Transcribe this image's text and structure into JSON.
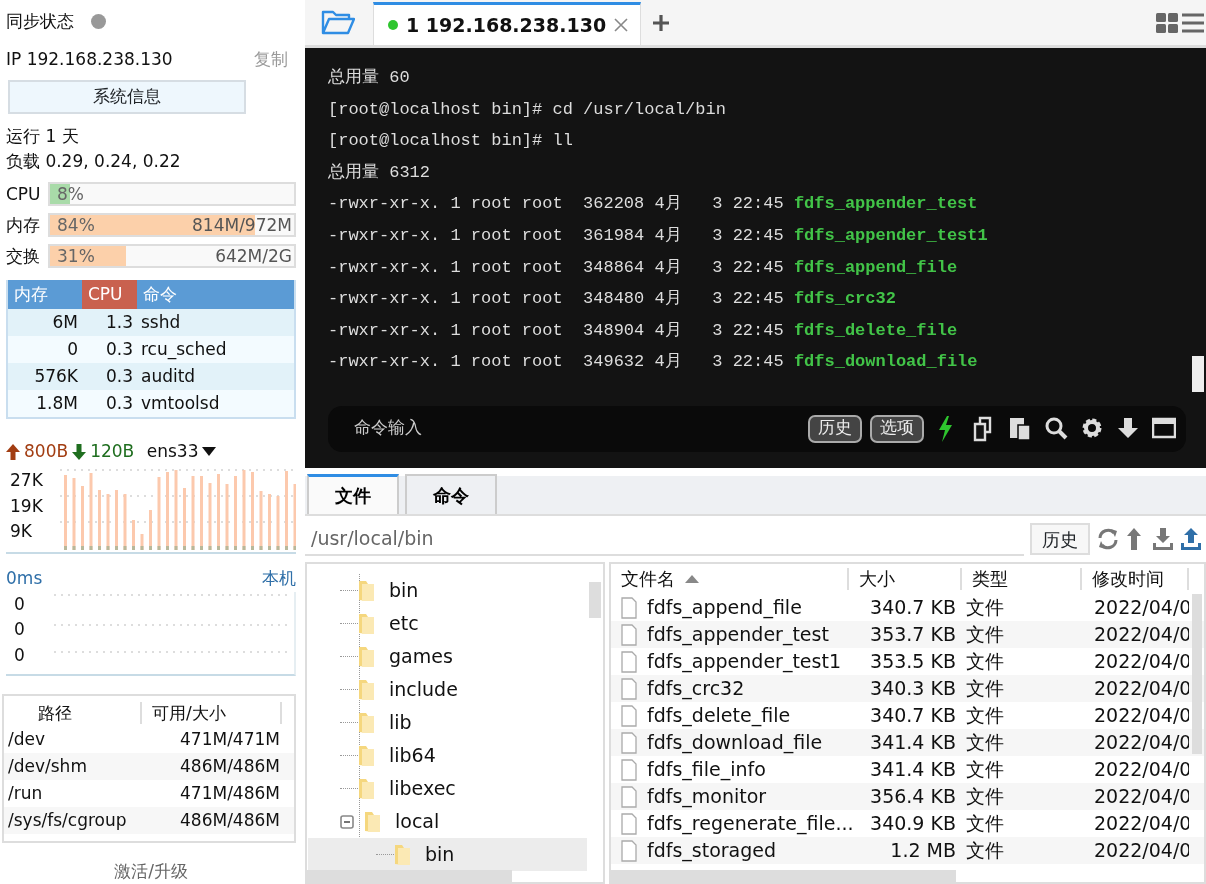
{
  "sidebar": {
    "sync_status": {
      "label": "同步状态",
      "on": false
    },
    "ip": {
      "label": "IP 192.168.238.130",
      "copy": "复制"
    },
    "sysinfo_button": "系统信息",
    "uptime": "运行 1 天",
    "load": "负载 0.29, 0.24, 0.22",
    "meters": [
      {
        "label": "CPU",
        "reading": "8%",
        "level": 0.08,
        "color": "#a9dba9"
      },
      {
        "label": "内存",
        "reading": "84%",
        "amount": "814M/972M",
        "level": 0.84,
        "color": "#fcd0aa"
      },
      {
        "label": "交换",
        "reading": "31%",
        "amount": "642M/2G",
        "level": 0.31,
        "color": "#fcd0aa"
      }
    ],
    "processes": {
      "columns": [
        {
          "label": "内存",
          "sorted": false
        },
        {
          "label": "CPU",
          "sorted": true
        },
        {
          "label": "命令",
          "sorted": false
        }
      ],
      "rows": [
        {
          "mem": "6M",
          "cpu": "1.3",
          "command": "sshd"
        },
        {
          "mem": "0",
          "cpu": "0.3",
          "command": "rcu_sched"
        },
        {
          "mem": "576K",
          "cpu": "0.3",
          "command": "auditd"
        },
        {
          "mem": "1.8M",
          "cpu": "0.3",
          "command": "vmtoolsd"
        }
      ]
    },
    "network": {
      "upload": "800B",
      "download": "120B",
      "interface": "ens33",
      "ticks": [
        "27K",
        "19K",
        "9K"
      ]
    },
    "ping": {
      "latency": "0ms",
      "host": "本机",
      "ticks": [
        "0",
        "0",
        "0"
      ]
    },
    "disks": {
      "columns": [
        "路径",
        "可用/大小"
      ],
      "rows": [
        {
          "path": "/dev",
          "usage": "471M/471M"
        },
        {
          "path": "/dev/shm",
          "usage": "486M/486M"
        },
        {
          "path": "/run",
          "usage": "471M/486M"
        },
        {
          "path": "/sys/fs/cgroup",
          "usage": "486M/486M"
        }
      ]
    },
    "footer": "激活/升级"
  },
  "main": {
    "session_tab": {
      "label": "1 192.168.238.130",
      "connected": true
    },
    "terminal": {
      "lines": [
        {
          "text": "总用量 60"
        },
        {
          "text": "[root@localhost bin]# cd /usr/local/bin"
        },
        {
          "text": "[root@localhost bin]# ll"
        },
        {
          "text": "总用量 6312"
        },
        {
          "text": "-rwxr-xr-x. 1 root root  362208 4月   3 22:45 ",
          "file": "fdfs_appender_test"
        },
        {
          "text": "-rwxr-xr-x. 1 root root  361984 4月   3 22:45 ",
          "file": "fdfs_appender_test1"
        },
        {
          "text": "-rwxr-xr-x. 1 root root  348864 4月   3 22:45 ",
          "file": "fdfs_append_file"
        },
        {
          "text": "-rwxr-xr-x. 1 root root  348480 4月   3 22:45 ",
          "file": "fdfs_crc32"
        },
        {
          "text": "-rwxr-xr-x. 1 root root  348904 4月   3 22:45 ",
          "file": "fdfs_delete_file"
        },
        {
          "text": "-rwxr-xr-x. 1 root root  349632 4月   3 22:45 ",
          "file": "fdfs_download_file"
        }
      ]
    },
    "command_bar": {
      "placeholder": "命令输入",
      "buttons": [
        "历史",
        "选项"
      ]
    },
    "bottom_tabs": [
      {
        "label": "文件",
        "selected": true
      },
      {
        "label": "命令",
        "selected": false
      }
    ],
    "path": "/usr/local/bin",
    "history_button": "历史",
    "tree": [
      {
        "label": "bin",
        "selected": false
      },
      {
        "label": "etc",
        "selected": false
      },
      {
        "label": "games",
        "selected": false
      },
      {
        "label": "include",
        "selected": false
      },
      {
        "label": "lib",
        "selected": false
      },
      {
        "label": "lib64",
        "selected": false
      },
      {
        "label": "libexec",
        "selected": false
      },
      {
        "label": "local",
        "selected": false,
        "expanded": true,
        "children": [
          {
            "label": "bin",
            "selected": true
          }
        ]
      }
    ],
    "files": {
      "columns": [
        {
          "label": "文件名",
          "sorted": true
        },
        {
          "label": "大小",
          "sorted": false
        },
        {
          "label": "类型",
          "sorted": false
        },
        {
          "label": "修改时间",
          "sorted": false
        }
      ],
      "rows": [
        {
          "name": "fdfs_append_file",
          "size": "340.7 KB",
          "type": "文件",
          "modified": "2022/04/0"
        },
        {
          "name": "fdfs_appender_test",
          "size": "353.7 KB",
          "type": "文件",
          "modified": "2022/04/0"
        },
        {
          "name": "fdfs_appender_test1",
          "size": "353.5 KB",
          "type": "文件",
          "modified": "2022/04/0"
        },
        {
          "name": "fdfs_crc32",
          "size": "340.3 KB",
          "type": "文件",
          "modified": "2022/04/0"
        },
        {
          "name": "fdfs_delete_file",
          "size": "340.7 KB",
          "type": "文件",
          "modified": "2022/04/0"
        },
        {
          "name": "fdfs_download_file",
          "size": "341.4 KB",
          "type": "文件",
          "modified": "2022/04/0"
        },
        {
          "name": "fdfs_file_info",
          "size": "341.4 KB",
          "type": "文件",
          "modified": "2022/04/0"
        },
        {
          "name": "fdfs_monitor",
          "size": "356.4 KB",
          "type": "文件",
          "modified": "2022/04/0"
        },
        {
          "name": "fdfs_regenerate_file...",
          "size": "340.9 KB",
          "type": "文件",
          "modified": "2022/04/0"
        },
        {
          "name": "fdfs_storaged",
          "size": "1.2 MB",
          "type": "文件",
          "modified": "2022/04/0"
        }
      ]
    }
  }
}
